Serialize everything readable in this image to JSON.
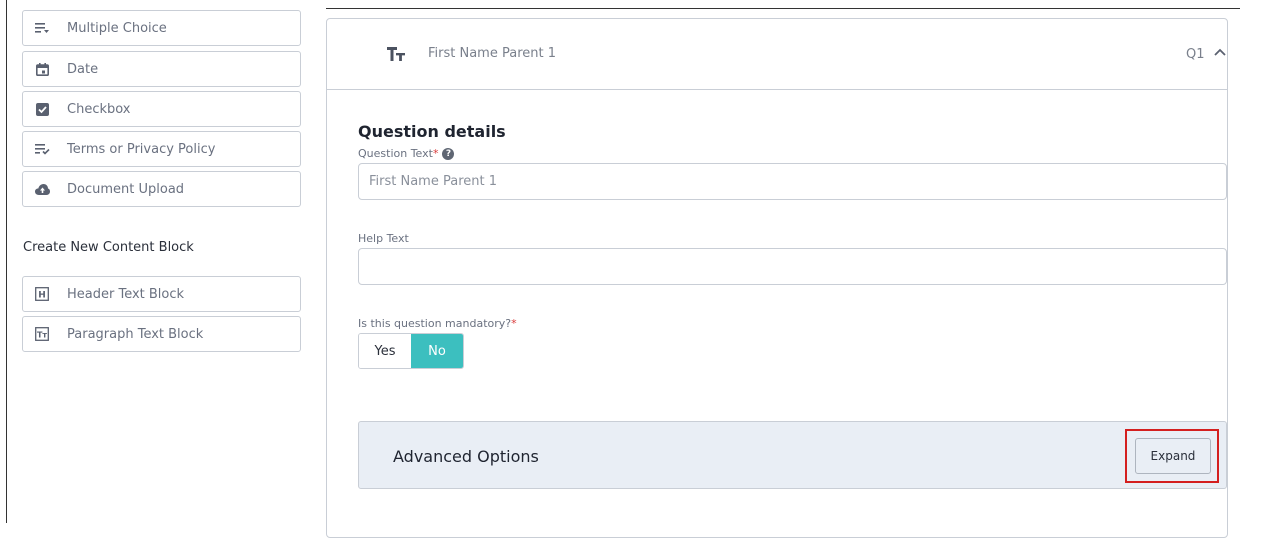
{
  "palette": {
    "question_types": [
      {
        "label": "Multiple Choice",
        "icon": "multiple-choice-icon"
      },
      {
        "label": "Date",
        "icon": "calendar-icon"
      },
      {
        "label": "Checkbox",
        "icon": "checkbox-icon"
      },
      {
        "label": "Terms or Privacy Policy",
        "icon": "terms-icon"
      },
      {
        "label": "Document Upload",
        "icon": "cloud-upload-icon"
      }
    ],
    "content_section_title": "Create New Content Block",
    "content_blocks": [
      {
        "label": "Header Text Block",
        "icon": "header-block-icon"
      },
      {
        "label": "Paragraph Text Block",
        "icon": "paragraph-block-icon"
      }
    ]
  },
  "question": {
    "type_icon_text": "TT",
    "title": "First Name Parent 1",
    "number": "Q1"
  },
  "details": {
    "title": "Question details",
    "question_text_label": "Question Text",
    "question_text_value": "First Name Parent 1",
    "required_mark": "*",
    "help_text_label": "Help Text",
    "help_text_value": "",
    "mandatory_label": "Is this question mandatory?",
    "mandatory_options": [
      "Yes",
      "No"
    ],
    "mandatory_selected": "No"
  },
  "advanced": {
    "title": "Advanced Options",
    "expand_label": "Expand"
  },
  "colors": {
    "accent": "#3cbfbf",
    "highlight": "#d41f1f",
    "panel_bg": "#e9eef5"
  }
}
